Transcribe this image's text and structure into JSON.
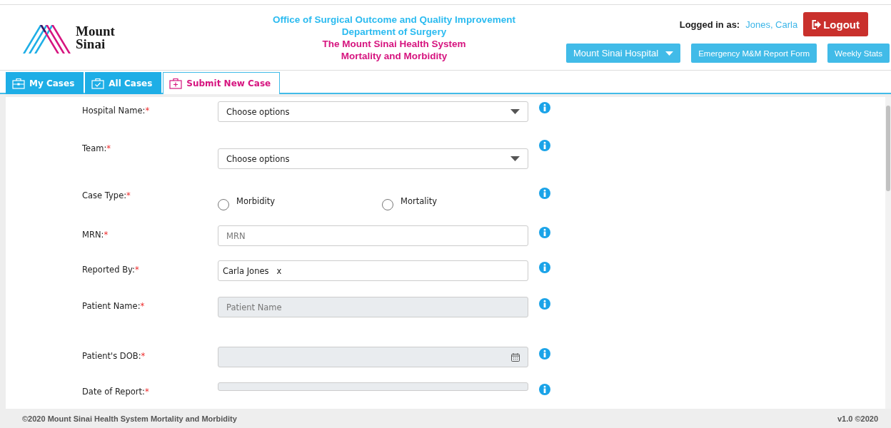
{
  "header": {
    "logo_text": [
      "Mount",
      "Sinai"
    ],
    "titles": [
      {
        "text": "Office of Surgical Outcome and Quality Improvement",
        "color": "#2bbbf0"
      },
      {
        "text": "Department of Surgery",
        "color": "#2bbbf0"
      },
      {
        "text": "The Mount Sinai Health System",
        "color": "#d6147f"
      },
      {
        "text": "Mortality and Morbidity",
        "color": "#d6147f"
      }
    ],
    "login_label": "Logged in as:",
    "user": "Jones, Carla",
    "logout": "Logout",
    "hospital_select": "Mount Sinai Hospital",
    "links": [
      "Emergency M&M Report Form",
      "Weekly Stats"
    ]
  },
  "tabs": [
    {
      "label": "My Cases",
      "selected": false
    },
    {
      "label": "All Cases",
      "selected": false
    },
    {
      "label": "Submit New Case",
      "selected": true
    }
  ],
  "form": [
    {
      "kind": "select",
      "label": "Hospital Name:",
      "required": "*",
      "value": "Choose options"
    },
    {
      "kind": "select",
      "label": "Team:",
      "required": "*",
      "value": "Choose options"
    },
    {
      "kind": "radio",
      "label": "Case Type:",
      "required": "*",
      "options": [
        {
          "label": "Morbidity",
          "selected": false
        },
        {
          "label": "Mortality",
          "selected": false
        }
      ]
    },
    {
      "kind": "text",
      "label": "MRN:",
      "required": "*",
      "placeholder": "MRN",
      "disabled": false
    },
    {
      "kind": "tags",
      "label": "Reported By:",
      "required": "*",
      "tags": [
        {
          "text": "Carla Jones",
          "remove": "x"
        }
      ]
    },
    {
      "kind": "text",
      "label": "Patient Name:",
      "required": "*",
      "placeholder": "Patient Name",
      "disabled": true
    },
    {
      "kind": "date",
      "label": "Patient's DOB:",
      "required": "*",
      "disabled": true
    },
    {
      "kind": "date_cut",
      "label": "Date of Report:",
      "required": "*",
      "disabled": true
    }
  ],
  "footer": {
    "left": "©2020 Mount Sinai Health System Mortality and Morbidity",
    "right": "v1.0 ©2020"
  }
}
